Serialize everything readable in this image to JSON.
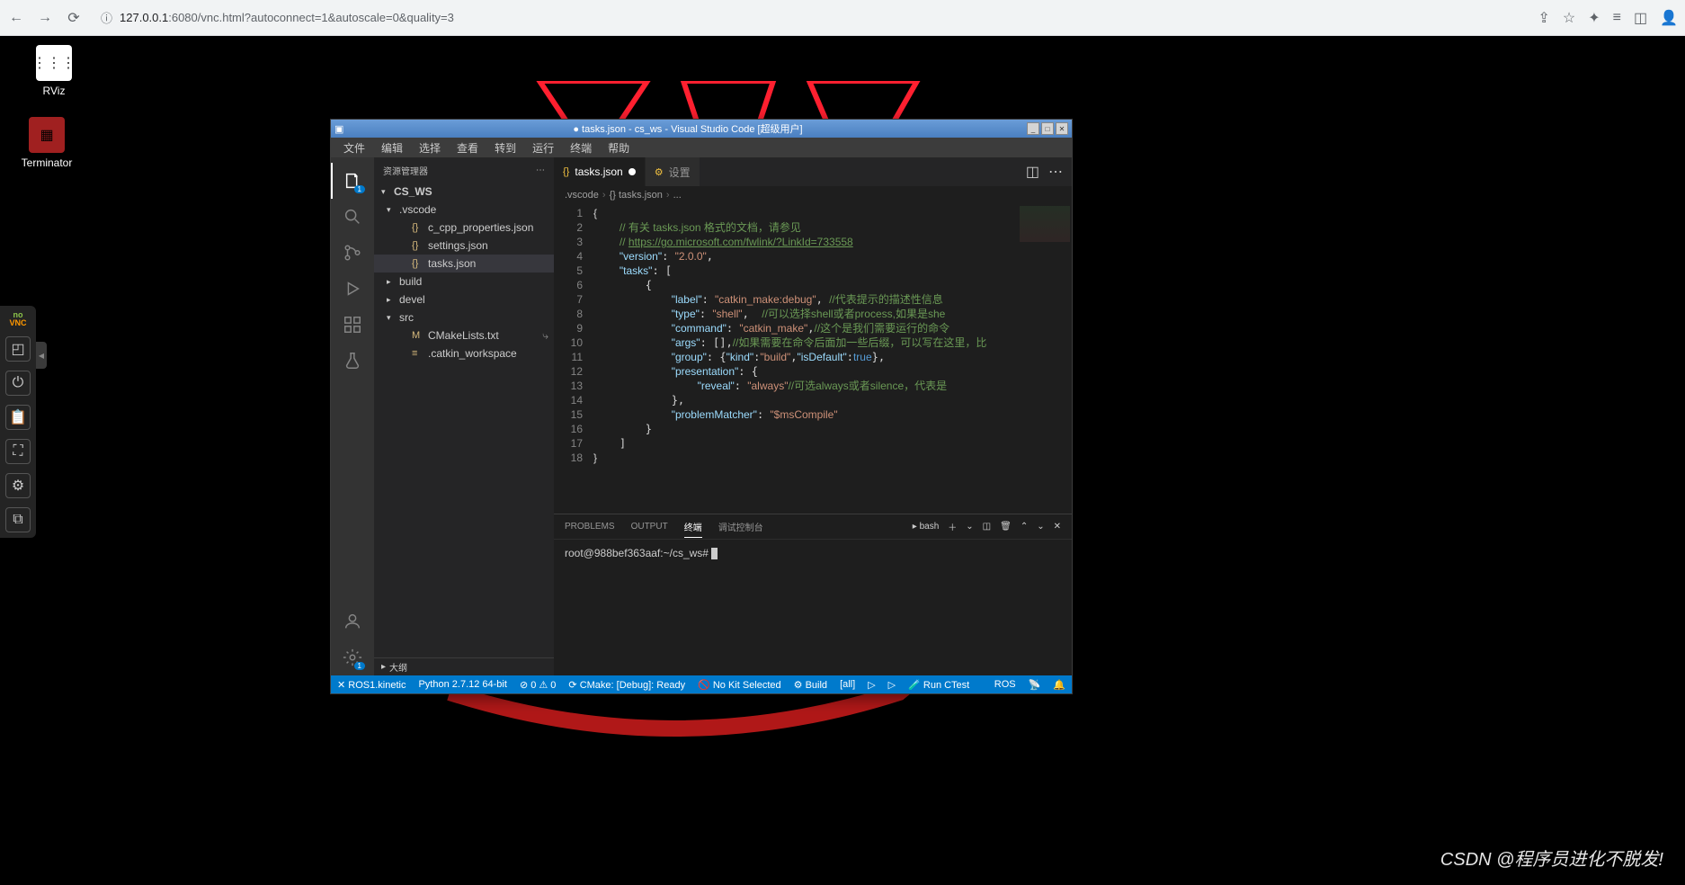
{
  "browser": {
    "url_prefix": "127.0.0.1",
    "url_rest": ":6080/vnc.html?autoconnect=1&autoscale=0&quality=3"
  },
  "desktop": {
    "icons": [
      {
        "name": "rviz",
        "label": "RViz"
      },
      {
        "name": "terminator",
        "label": "Terminator"
      }
    ]
  },
  "novnc": {
    "label": "noVNC"
  },
  "vscode": {
    "title": "● tasks.json - cs_ws - Visual Studio Code [超级用户]",
    "menu": [
      "文件",
      "编辑",
      "选择",
      "查看",
      "转到",
      "运行",
      "终端",
      "帮助"
    ],
    "activity": {
      "explorer_badge": "1",
      "settings_badge": "1"
    },
    "sidebar": {
      "title": "资源管理器",
      "root": "CS_WS",
      "tree": [
        {
          "type": "folder",
          "name": ".vscode",
          "expanded": true,
          "depth": 1
        },
        {
          "type": "file",
          "name": "c_cpp_properties.json",
          "icon": "{}",
          "depth": 2
        },
        {
          "type": "file",
          "name": "settings.json",
          "icon": "{}",
          "depth": 2
        },
        {
          "type": "file",
          "name": "tasks.json",
          "icon": "{}",
          "depth": 2,
          "selected": true
        },
        {
          "type": "folder",
          "name": "build",
          "expanded": false,
          "depth": 1
        },
        {
          "type": "folder",
          "name": "devel",
          "expanded": false,
          "depth": 1
        },
        {
          "type": "folder",
          "name": "src",
          "expanded": true,
          "depth": 1
        },
        {
          "type": "file",
          "name": "CMakeLists.txt",
          "icon": "M",
          "depth": 2,
          "badge": "⤷"
        },
        {
          "type": "file",
          "name": ".catkin_workspace",
          "icon": "≡",
          "depth": 2
        }
      ],
      "outline": "大纲"
    },
    "tabs": {
      "open": [
        {
          "label": "tasks.json",
          "icon": "{}",
          "dirty": true,
          "active": true
        },
        {
          "label": "设置",
          "icon": "⚙",
          "dirty": false,
          "active": false
        }
      ]
    },
    "breadcrumb": [
      ".vscode",
      "{} tasks.json",
      "..."
    ],
    "editor": {
      "lines": [
        "1",
        "2",
        "3",
        "4",
        "5",
        "6",
        "7",
        "8",
        "9",
        "10",
        "11",
        "12",
        "13",
        "14",
        "15",
        "16",
        "17",
        "18"
      ],
      "code": {
        "l1": "{",
        "l2_comment": "// 有关 tasks.json 格式的文档，请参见",
        "l3_prefix": "// ",
        "l3_url": "https://go.microsoft.com/fwlink/?LinkId=733558",
        "l4_k": "\"version\"",
        "l4_v": "\"2.0.0\"",
        "l5_k": "\"tasks\"",
        "l7_k": "\"label\"",
        "l7_v": "\"catkin_make:debug\"",
        "l7_c": "//代表提示的描述性信息",
        "l8_k": "\"type\"",
        "l8_v": "\"shell\"",
        "l8_c": "//可以选择shell或者process,如果是she",
        "l9_k": "\"command\"",
        "l9_v": "\"catkin_make\"",
        "l9_c": "//这个是我们需要运行的命令",
        "l10_k": "\"args\"",
        "l10_c": "//如果需要在命令后面加一些后缀，可以写在这里，比",
        "l11_k": "\"group\"",
        "l11_kind_k": "\"kind\"",
        "l11_kind_v": "\"build\"",
        "l11_def_k": "\"isDefault\"",
        "l11_def_v": "true",
        "l12_k": "\"presentation\"",
        "l13_k": "\"reveal\"",
        "l13_v": "\"always\"",
        "l13_c": "//可选always或者silence，代表是",
        "l15_k": "\"problemMatcher\"",
        "l15_v": "\"$msCompile\""
      }
    },
    "panel": {
      "tabs": [
        "PROBLEMS",
        "OUTPUT",
        "终端",
        "调试控制台"
      ],
      "active_tab": 2,
      "shell_label": "bash",
      "prompt": "root@988bef363aaf:~/cs_ws# "
    },
    "statusbar": {
      "left": [
        {
          "text": "✕ ROS1.kinetic"
        },
        {
          "text": "Python 2.7.12 64-bit"
        },
        {
          "text": "⊘ 0 ⚠ 0"
        },
        {
          "text": "⟳ CMake: [Debug]: Ready"
        },
        {
          "text": "🚫 No Kit Selected"
        },
        {
          "text": "⚙ Build"
        },
        {
          "text": "[all]"
        },
        {
          "text": "▷"
        },
        {
          "text": "▷"
        },
        {
          "text": "🧪 Run CTest"
        }
      ],
      "right": [
        {
          "text": "ROS"
        },
        {
          "text": "📡"
        },
        {
          "text": "🔔"
        }
      ]
    }
  },
  "watermark": "CSDN @程序员进化不脱发!"
}
